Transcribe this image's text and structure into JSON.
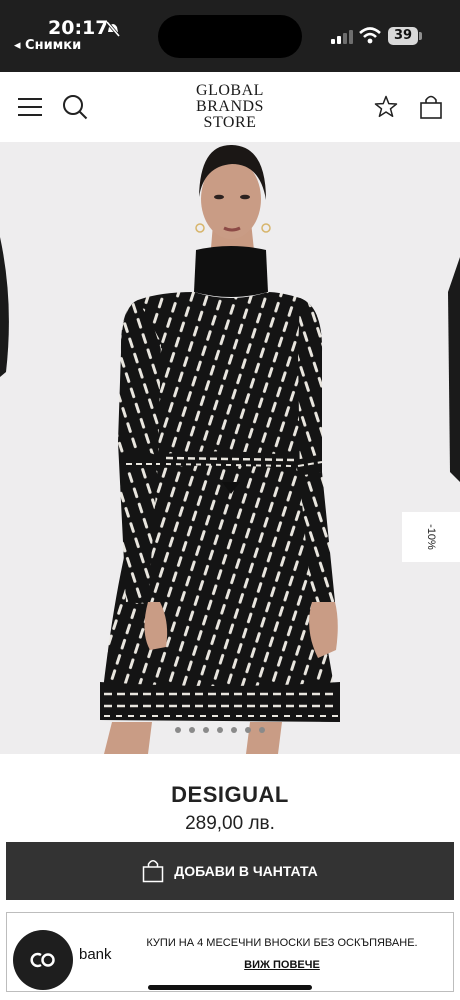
{
  "status_bar": {
    "time": "20:17",
    "back_label": "◂ Снимки",
    "battery": "39"
  },
  "header": {
    "logo_line1": "GLOBAL",
    "logo_line2": "BRANDS",
    "logo_line3": "STORE"
  },
  "product": {
    "discount_badge": "-10%",
    "brand": "DESIGUAL",
    "price": "289,00 лв.",
    "add_to_bag_label": "ДОБАВИ В ЧАНТАТА"
  },
  "installments": {
    "badge_text": "CO",
    "bank_label": "bank",
    "text": "КУПИ НА 4 МЕСЕЧНИ ВНОСКИ БЕЗ ОСКЪПЯВАНЕ.",
    "link_label": "ВИЖ ПОВЕЧЕ"
  },
  "colors": {
    "status_bar_bg": "#1f1f1f",
    "button_bg": "#333333",
    "image_bg": "#eeedee"
  }
}
